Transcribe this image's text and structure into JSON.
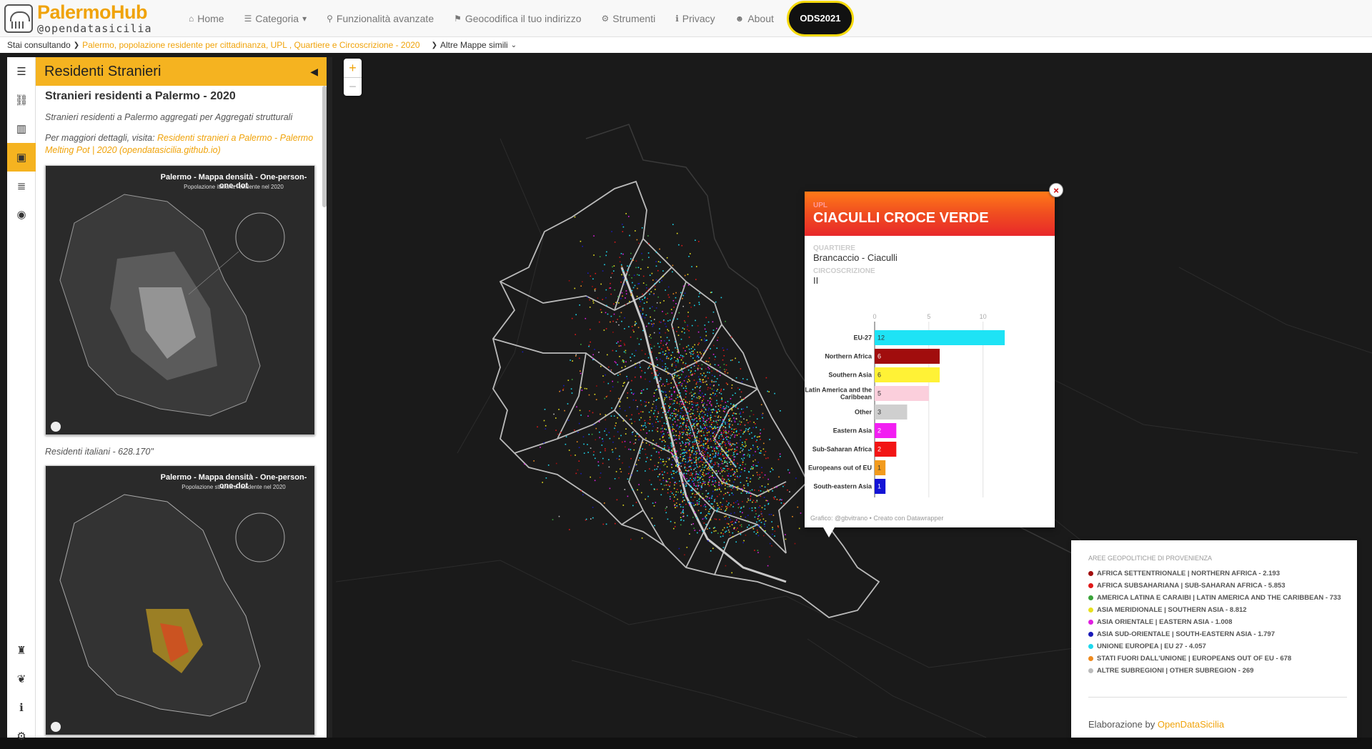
{
  "brand": {
    "title": "PalermoHub",
    "subtitle": "@opendatasicilia"
  },
  "nav": {
    "home": "Home",
    "categoria": "Categoria",
    "funzionalita": "Funzionalità avanzate",
    "geocodifica": "Geocodifica il tuo indirizzo",
    "strumenti": "Strumenti",
    "privacy": "Privacy",
    "about": "About",
    "ods": "ODS2021"
  },
  "breadcrumb": {
    "prefix": "Stai consultando",
    "current": "Palermo, popolazione residente per cittadinanza, UPL , Quartiere e Circoscrizione - 2020",
    "similar": "Altre Mappe simili"
  },
  "panel": {
    "header": "Residenti Stranieri",
    "title": "Stranieri residenti a Palermo - 2020",
    "desc": "Stranieri residenti a Palermo aggregati per Aggregati strutturali",
    "more_prefix": "Per maggiori dettagli, visita:",
    "more_link": "Residenti stranieri a Palermo - Palermo Melting Pot | 2020 (opendatasicilia.github.io)",
    "thumb1": {
      "title": "Palermo - Mappa densità - One-person-one-dot",
      "subtitle": "Popolazione italiana residente nel 2020",
      "caption": "Residenti italiani - 628.170\""
    },
    "thumb2": {
      "title": "Palermo - Mappa densità - One-person-one-dot",
      "subtitle": "Popolazione straniera residente nel 2020"
    }
  },
  "popup": {
    "upl_label": "UPL",
    "upl_value": "CIACULLI CROCE VERDE",
    "quartiere_label": "QUARTIERE",
    "quartiere_value": "Brancaccio - Ciaculli",
    "circ_label": "CIRCOSCRIZIONE",
    "circ_value": "II",
    "credit": "Grafico: @gbvitrano • Creato con Datawrapper"
  },
  "chart_data": {
    "type": "bar",
    "orientation": "horizontal",
    "categories": [
      "EU-27",
      "Northern Africa",
      "Southern Asia",
      "Latin America and the Caribbean",
      "Other",
      "Eastern Asia",
      "Sub-Saharan Africa",
      "Europeans out of EU",
      "South-eastern Asia"
    ],
    "values": [
      12,
      6,
      6,
      5,
      3,
      2,
      2,
      1,
      1
    ],
    "colors": [
      "#1ee3f5",
      "#a10d0d",
      "#fff236",
      "#fbcfdc",
      "#cfcfcf",
      "#f21ef2",
      "#f21414",
      "#f29b1e",
      "#1414d6"
    ],
    "value_label_colors": [
      "#333333",
      "#ffffff",
      "#333333",
      "#333333",
      "#333333",
      "#ffffff",
      "#ffffff",
      "#333333",
      "#ffffff"
    ],
    "xticks": [
      0,
      5,
      10
    ],
    "xlim": [
      0,
      12
    ]
  },
  "legend": {
    "title": "AREE GEOPOLITICHE DI PROVENIENZA",
    "items": [
      {
        "label": "AFRICA SETTENTRIONALE | NORTHERN AFRICA - 2.193",
        "color": "#a10d0d"
      },
      {
        "label": "AFRICA SUBSAHARIANA | SUB-SAHARAN AFRICA - 5.853",
        "color": "#e01818"
      },
      {
        "label": "AMERICA LATINA E CARAIBI | LATIN AMERICA AND THE CARIBBEAN - 733",
        "color": "#3aa33a"
      },
      {
        "label": "ASIA MERIDIONALE | SOUTHERN ASIA - 8.812",
        "color": "#e8e020"
      },
      {
        "label": "ASIA ORIENTALE | EASTERN ASIA - 1.008",
        "color": "#e01ee0"
      },
      {
        "label": "ASIA SUD-ORIENTALE | SOUTH-EASTERN ASIA - 1.797",
        "color": "#1a1ab8"
      },
      {
        "label": "UNIONE EUROPEA | EU 27 - 4.057",
        "color": "#1ed8ee"
      },
      {
        "label": "STATI FUORI DALL'UNIONE | EUROPEANS OUT OF EU - 678",
        "color": "#ee8a1e"
      },
      {
        "label": "ALTRE SUBREGIONI | OTHER SUBREGION - 269",
        "color": "#bbbbbb"
      }
    ],
    "credit_prefix": "Elaborazione by",
    "credit_link": "OpenDataSicilia"
  }
}
